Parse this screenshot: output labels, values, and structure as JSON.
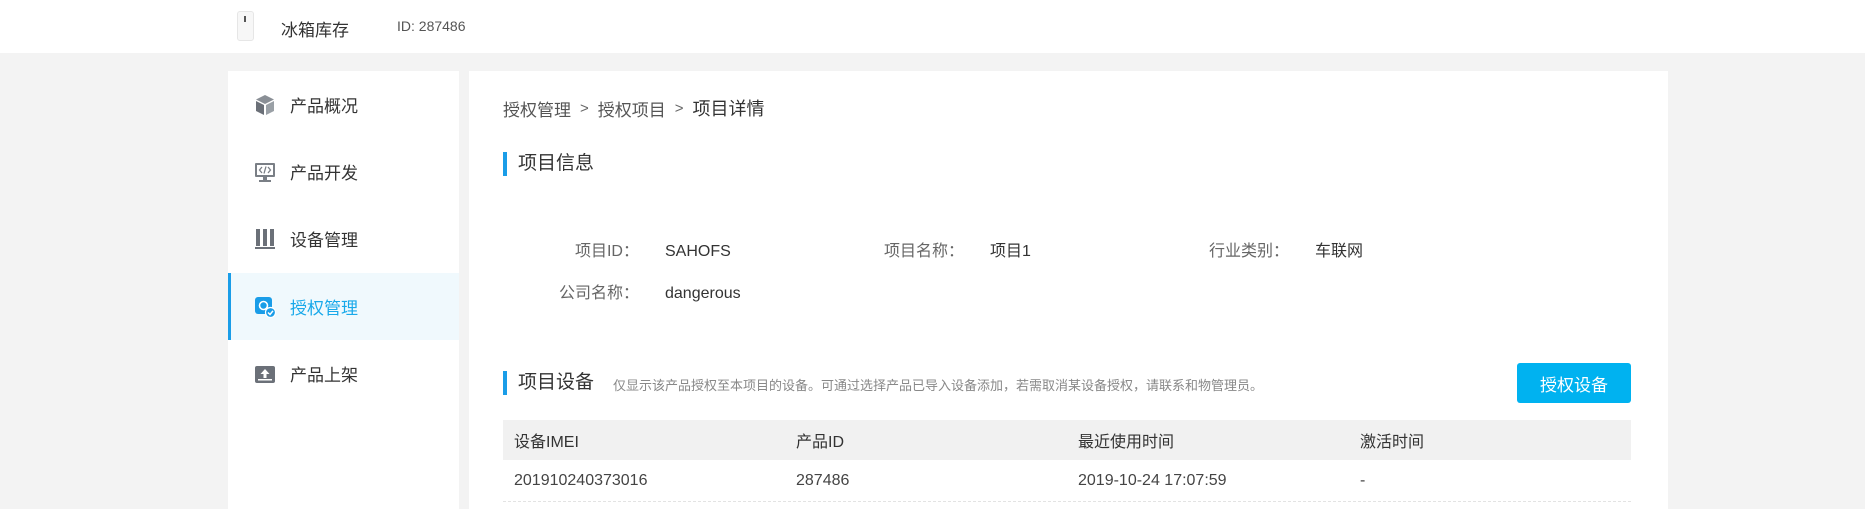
{
  "header": {
    "product_name": "冰箱库存",
    "product_id": "ID: 287486"
  },
  "sidebar": {
    "items": [
      {
        "label": "产品概况",
        "icon": "cube-icon",
        "active": false
      },
      {
        "label": "产品开发",
        "icon": "code-monitor-icon",
        "active": false
      },
      {
        "label": "设备管理",
        "icon": "device-bars-icon",
        "active": false
      },
      {
        "label": "授权管理",
        "icon": "authorization-icon",
        "active": true
      },
      {
        "label": "产品上架",
        "icon": "upload-tray-icon",
        "active": false
      }
    ]
  },
  "breadcrumb": {
    "items": [
      "授权管理",
      "授权项目"
    ],
    "current": "项目详情",
    "separator": ">"
  },
  "project_info": {
    "title": "项目信息",
    "fields": {
      "project_id": {
        "label": "项目ID：",
        "value": "SAHOFS"
      },
      "project_name": {
        "label": "项目名称：",
        "value": "项目1"
      },
      "industry": {
        "label": "行业类别：",
        "value": "车联网"
      },
      "company": {
        "label": "公司名称：",
        "value": "dangerous"
      }
    }
  },
  "project_devices": {
    "title": "项目设备",
    "hint": "仅显示该产品授权至本项目的设备。可通过选择产品已导入设备添加，若需取消某设备授权，请联系和物管理员。",
    "authorize_button": "授权设备",
    "columns": [
      "设备IMEI",
      "产品ID",
      "最近使用时间",
      "激活时间"
    ],
    "rows": [
      [
        "201910240373016",
        "287486",
        "2019-10-24 17:07:59",
        "-"
      ]
    ]
  },
  "colors": {
    "accent": "#1a9de8",
    "button": "#00b2f0",
    "active_bg": "#f0f9fd",
    "page_bg": "#f3f3f3"
  }
}
